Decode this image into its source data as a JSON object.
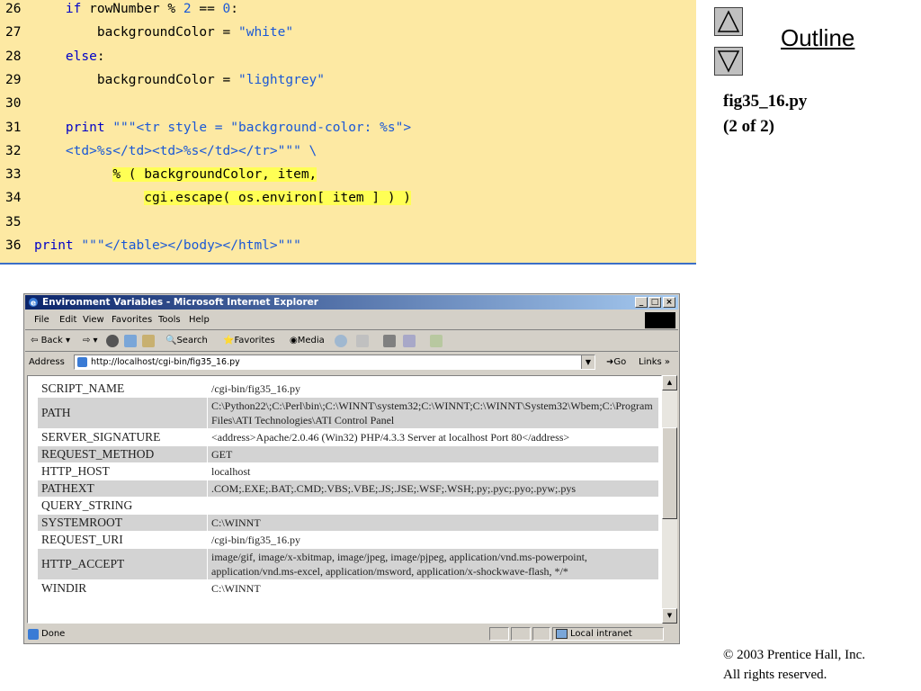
{
  "code": {
    "lines": [
      {
        "num": "26",
        "indent": "    ",
        "parts": [
          {
            "t": "if",
            "c": "kw"
          },
          {
            "t": " rowNumber % ",
            "c": "txt"
          },
          {
            "t": "2",
            "c": "num"
          },
          {
            "t": " == ",
            "c": "txt"
          },
          {
            "t": "0",
            "c": "num"
          },
          {
            "t": ":",
            "c": "txt"
          }
        ]
      },
      {
        "num": "27",
        "indent": "        ",
        "parts": [
          {
            "t": "backgroundColor = ",
            "c": "txt"
          },
          {
            "t": "\"white\"",
            "c": "str"
          }
        ]
      },
      {
        "num": "28",
        "indent": "    ",
        "parts": [
          {
            "t": "else",
            "c": "kw"
          },
          {
            "t": ":",
            "c": "txt"
          }
        ]
      },
      {
        "num": "29",
        "indent": "        ",
        "parts": [
          {
            "t": "backgroundColor = ",
            "c": "txt"
          },
          {
            "t": "\"lightgrey\"",
            "c": "str"
          }
        ]
      },
      {
        "num": "30",
        "indent": "",
        "parts": []
      },
      {
        "num": "31",
        "indent": "    ",
        "parts": [
          {
            "t": "print",
            "c": "kw"
          },
          {
            "t": " ",
            "c": "txt"
          },
          {
            "t": "\"\"\"<tr style = \"background-color: %s\">",
            "c": "str"
          }
        ]
      },
      {
        "num": "32",
        "indent": "    ",
        "parts": [
          {
            "t": "<td>%s</td><td>%s</td></tr>\"\"\" \\",
            "c": "str"
          }
        ]
      },
      {
        "num": "33",
        "indent": "          ",
        "parts": [
          {
            "t": "% ( backgroundColor, item,",
            "c": "txt hl"
          }
        ]
      },
      {
        "num": "34",
        "indent": "              ",
        "parts": [
          {
            "t": "cgi.escape( os.environ[ item ] ) )",
            "c": "txt hl"
          }
        ]
      },
      {
        "num": "35",
        "indent": "",
        "parts": []
      },
      {
        "num": "36",
        "indent": "",
        "parts": [
          {
            "t": "print",
            "c": "kw"
          },
          {
            "t": " ",
            "c": "txt"
          },
          {
            "t": "\"\"\"</table></body></html>\"\"\"",
            "c": "str"
          }
        ]
      }
    ]
  },
  "outline": {
    "link": "Outline",
    "fig_title": "fig35_16.py",
    "fig_sub": "(2 of 2)",
    "copyright_line1": "© 2003 Prentice Hall, Inc.",
    "copyright_line2": "All rights reserved."
  },
  "browser": {
    "title": "Environment Variables - Microsoft Internet Explorer",
    "menu": [
      "File",
      "Edit",
      "View",
      "Favorites",
      "Tools",
      "Help"
    ],
    "toolbar": {
      "back": "Back",
      "search": "Search",
      "favorites": "Favorites",
      "media": "Media"
    },
    "address_label": "Address",
    "address_url": "http://localhost/cgi-bin/fig35_16.py",
    "go": "Go",
    "links": "Links »",
    "status": "Done",
    "zone": "Local intranet",
    "rows": [
      {
        "key": "SCRIPT_NAME",
        "value": "/cgi-bin/fig35_16.py",
        "grey": false
      },
      {
        "key": "PATH",
        "value": "C:\\Python22\\;C:\\Perl\\bin\\;C:\\WINNT\\system32;C:\\WINNT;C:\\WINNT\\System32\\Wbem;C:\\Program Files\\ATI Technologies\\ATI Control Panel",
        "grey": true
      },
      {
        "key": "SERVER_SIGNATURE",
        "value": "<address>Apache/2.0.46 (Win32) PHP/4.3.3 Server at localhost Port 80</address>",
        "grey": false
      },
      {
        "key": "REQUEST_METHOD",
        "value": "GET",
        "grey": true
      },
      {
        "key": "HTTP_HOST",
        "value": "localhost",
        "grey": false
      },
      {
        "key": "PATHEXT",
        "value": ".COM;.EXE;.BAT;.CMD;.VBS;.VBE;.JS;.JSE;.WSF;.WSH;.py;.pyc;.pyo;.pyw;.pys",
        "grey": true
      },
      {
        "key": "QUERY_STRING",
        "value": "",
        "grey": false
      },
      {
        "key": "SYSTEMROOT",
        "value": "C:\\WINNT",
        "grey": true
      },
      {
        "key": "REQUEST_URI",
        "value": "/cgi-bin/fig35_16.py",
        "grey": false
      },
      {
        "key": "HTTP_ACCEPT",
        "value": "image/gif, image/x-xbitmap, image/jpeg, image/pjpeg, application/vnd.ms-powerpoint, application/vnd.ms-excel, application/msword, application/x-shockwave-flash, */*",
        "grey": true
      },
      {
        "key": "WINDIR",
        "value": "C:\\WINNT",
        "grey": false
      }
    ]
  },
  "colors": {
    "code_bg": "#fde9a3",
    "keyword": "#0000c8",
    "string": "#1a58d6",
    "highlight": "#ffff55",
    "row_grey": "#d3d3d3"
  }
}
